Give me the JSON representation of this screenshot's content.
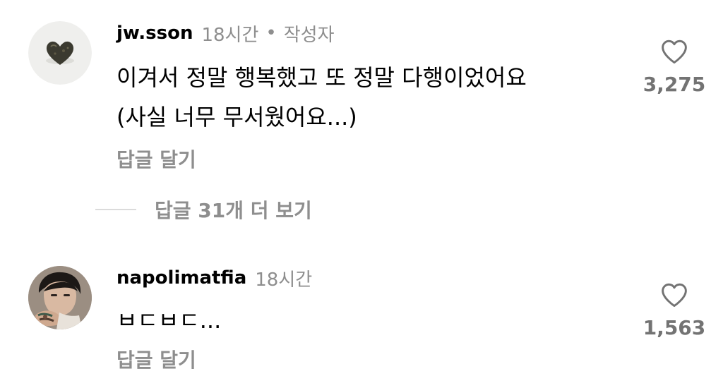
{
  "comments": [
    {
      "avatar_icon": "heart-stone-avatar",
      "username": "jw.sson",
      "time": "18시간",
      "separator": "•",
      "author_badge": "작성자",
      "text_lines": [
        "이겨서 정말 행복했고 또 정말 다행이었어요",
        "(사실 너무 무서웠어요...)"
      ],
      "reply_label": "답글 달기",
      "like_icon": "heart-outline-icon",
      "like_count": "3,275"
    },
    {
      "avatar_icon": "person-avatar",
      "username": "napolimatfia",
      "time": "18시간",
      "text_lines": [
        "ㅂㄷㅂㄷ..."
      ],
      "reply_label": "답글 달기",
      "like_icon": "heart-outline-icon",
      "like_count": "1,563"
    }
  ],
  "view_replies": {
    "label": "답글 31개 더 보기"
  },
  "colors": {
    "primary_text": "#000000",
    "secondary_text": "#8e8e8e",
    "like_count": "#737373",
    "divider": "#dbdbdb"
  }
}
